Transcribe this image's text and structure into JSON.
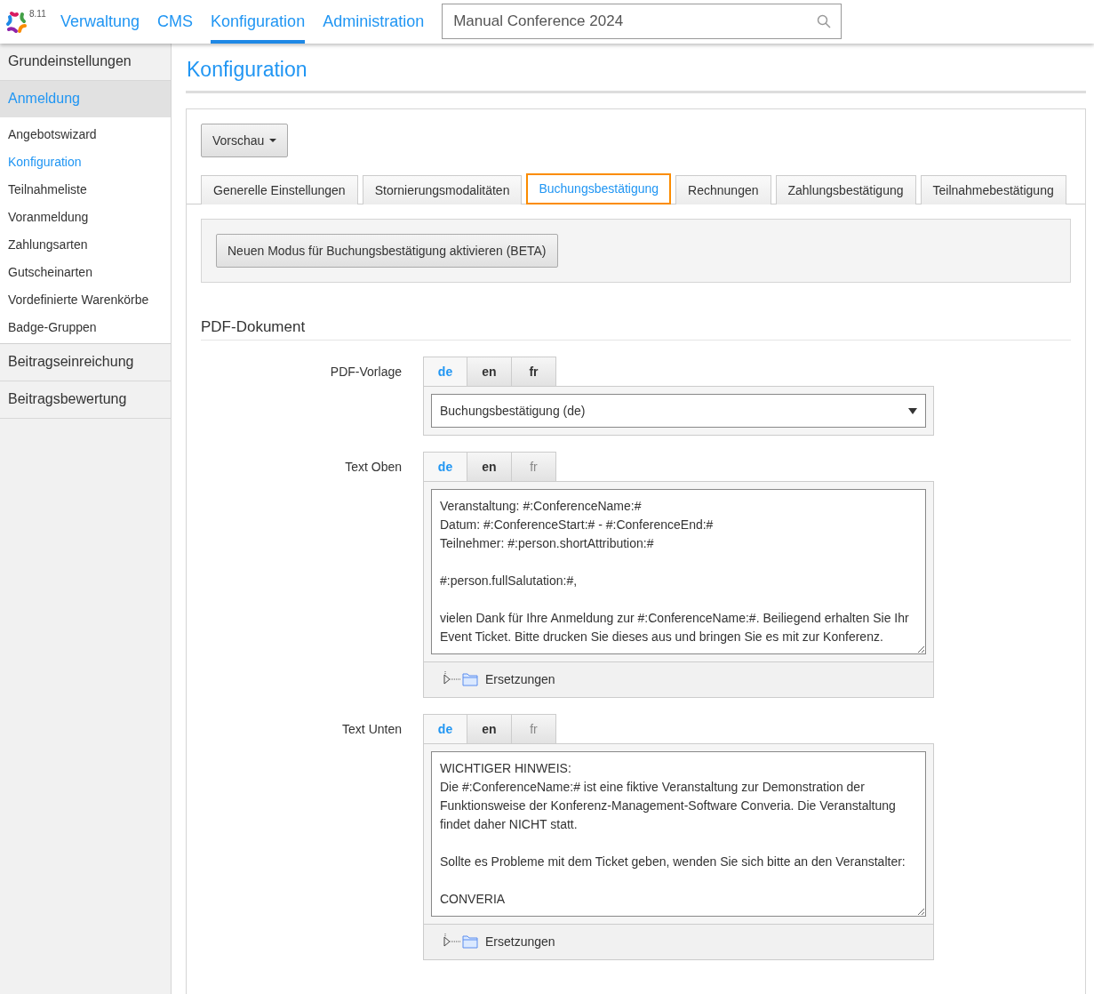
{
  "app": {
    "version": "8.11"
  },
  "nav": [
    {
      "label": "Verwaltung",
      "selected": false
    },
    {
      "label": "CMS",
      "selected": false
    },
    {
      "label": "Konfiguration",
      "selected": true
    },
    {
      "label": "Administration",
      "selected": false
    }
  ],
  "search": {
    "value": "Manual Conference 2024"
  },
  "sidebar": {
    "sections": [
      {
        "label": "Grundeinstellungen",
        "selected": false
      },
      {
        "label": "Anmeldung",
        "selected": true,
        "children": [
          {
            "label": "Angebotswizard",
            "selected": false
          },
          {
            "label": "Konfiguration",
            "selected": true
          },
          {
            "label": "Teilnahmeliste",
            "selected": false
          },
          {
            "label": "Voranmeldung",
            "selected": false
          },
          {
            "label": "Zahlungsarten",
            "selected": false
          },
          {
            "label": "Gutscheinarten",
            "selected": false
          },
          {
            "label": "Vordefinierte Warenkörbe",
            "selected": false
          },
          {
            "label": "Badge-Gruppen",
            "selected": false
          }
        ]
      },
      {
        "label": "Beitragseinreichung",
        "selected": false
      },
      {
        "label": "Beitragsbewertung",
        "selected": false
      }
    ]
  },
  "page": {
    "title": "Konfiguration"
  },
  "preview_button": {
    "label": "Vorschau"
  },
  "tabs": [
    {
      "label": "Generelle Einstellungen",
      "selected": false
    },
    {
      "label": "Stornierungsmodalitäten",
      "selected": false
    },
    {
      "label": "Buchungsbestätigung",
      "selected": true
    },
    {
      "label": "Rechnungen",
      "selected": false
    },
    {
      "label": "Zahlungsbestätigung",
      "selected": false
    },
    {
      "label": "Teilnahmebestätigung",
      "selected": false
    }
  ],
  "beta_button": {
    "label": "Neuen Modus für Buchungsbestätigung aktivieren (BETA)"
  },
  "section_title": "PDF-Dokument",
  "fields": [
    {
      "label": "PDF-Vorlage",
      "kind": "select",
      "value": "Buchungsbestätigung (de)",
      "languages": [
        {
          "label": "de",
          "selected": true,
          "dimmed": false
        },
        {
          "label": "en",
          "selected": false,
          "dimmed": false
        },
        {
          "label": "fr",
          "selected": false,
          "dimmed": false
        }
      ]
    },
    {
      "label": "Text Oben",
      "kind": "textarea",
      "value": "Veranstaltung: #:ConferenceName:#\nDatum: #:ConferenceStart:# - #:ConferenceEnd:#\nTeilnehmer: #:person.shortAttribution:#\n\n#:person.fullSalutation:#,\n\nvielen Dank für Ihre Anmeldung zur #:ConferenceName:#. Beiliegend erhalten Sie Ihr Event Ticket. Bitte drucken Sie dieses aus und bringen Sie es mit zur Konferenz.",
      "languages": [
        {
          "label": "de",
          "selected": true,
          "dimmed": false
        },
        {
          "label": "en",
          "selected": false,
          "dimmed": false
        },
        {
          "label": "fr",
          "selected": false,
          "dimmed": true
        }
      ],
      "tree": {
        "label": "Ersetzungen",
        "expanded": false
      }
    },
    {
      "label": "Text Unten",
      "kind": "textarea",
      "value": "WICHTIGER HINWEIS:\nDie #:ConferenceName:# ist eine fiktive Veranstaltung zur Demonstration der Funktionsweise der Konferenz-Management-Software Converia. Die Veranstaltung findet daher NICHT statt.\n\nSollte es Probleme mit dem Ticket geben, wenden Sie sich bitte an den Veranstalter:\n\nCONVERIA",
      "languages": [
        {
          "label": "de",
          "selected": true,
          "dimmed": false
        },
        {
          "label": "en",
          "selected": false,
          "dimmed": false
        },
        {
          "label": "fr",
          "selected": false,
          "dimmed": true
        }
      ],
      "tree": {
        "label": "Ersetzungen",
        "expanded": false
      }
    }
  ]
}
